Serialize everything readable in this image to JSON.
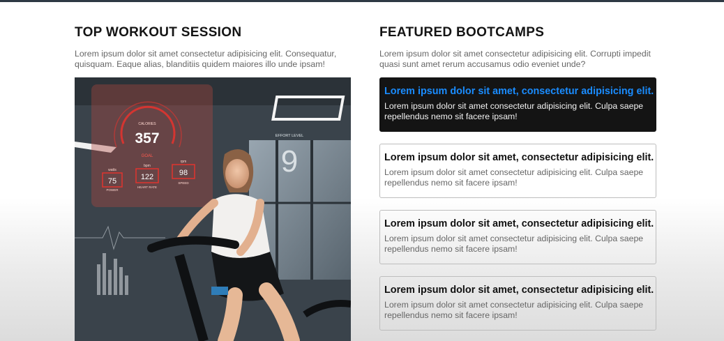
{
  "left": {
    "title": "TOP WORKOUT SESSION",
    "intro": "Lorem ipsum dolor sit amet consectetur adipisicing elit. Consequatur, quisquam. Eaque alias, blanditiis quidem maiores illo unde ipsam!",
    "image": {
      "hud": {
        "calories_label": "CALORIES",
        "calories_value": "357",
        "goal_label": "GOAL",
        "power_label": "POWER",
        "power_value": "75",
        "power_unit": "watts",
        "heart_label": "HEART RATE",
        "heart_value": "122",
        "heart_unit": "bpm",
        "speed_label": "SPEED",
        "speed_value": "98",
        "speed_unit": "rpm",
        "effort_label": "EFFORT LEVEL",
        "effort_value": "9"
      }
    }
  },
  "right": {
    "title": "FEATURED BOOTCAMPS",
    "intro": "Lorem ipsum dolor sit amet consectetur adipisicing elit. Corrupti impedit quasi sunt amet rerum accusamus odio eveniet unde?",
    "cards": [
      {
        "title": "Lorem ipsum dolor sit amet, consectetur adipisicing elit.",
        "body": "Lorem ipsum dolor sit amet consectetur adipisicing elit. Culpa saepe repellendus nemo sit facere ipsam!",
        "active": true
      },
      {
        "title": "Lorem ipsum dolor sit amet, consectetur adipisicing elit.",
        "body": "Lorem ipsum dolor sit amet consectetur adipisicing elit. Culpa saepe repellendus nemo sit facere ipsam!",
        "active": false
      },
      {
        "title": "Lorem ipsum dolor sit amet, consectetur adipisicing elit.",
        "body": "Lorem ipsum dolor sit amet consectetur adipisicing elit. Culpa saepe repellendus nemo sit facere ipsam!",
        "active": false
      },
      {
        "title": "Lorem ipsum dolor sit amet, consectetur adipisicing elit.",
        "body": "Lorem ipsum dolor sit amet consectetur adipisicing elit. Culpa saepe repellendus nemo sit facere ipsam!",
        "active": false
      }
    ]
  },
  "colors": {
    "top_bar": "#2e3944",
    "active_card_bg": "#141414",
    "active_card_title": "#1a8cff",
    "hud_red": "#e0342f"
  }
}
